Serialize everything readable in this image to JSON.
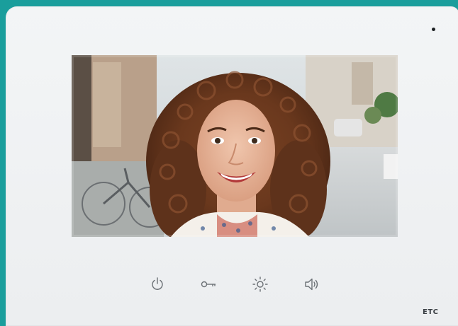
{
  "device": {
    "brand_label": "ETC",
    "screen": {
      "content": "video-feed",
      "caller_image": "smiling-woman-curly-hair"
    },
    "buttons": [
      {
        "name": "power-button",
        "icon": "power-icon"
      },
      {
        "name": "unlock-button",
        "icon": "key-icon"
      },
      {
        "name": "brightness-button",
        "icon": "sun-icon"
      },
      {
        "name": "volume-button",
        "icon": "speaker-icon"
      }
    ]
  },
  "colors": {
    "background": "#1a9e9c",
    "panel": "#eef0f2",
    "icon": "#6b7075"
  }
}
